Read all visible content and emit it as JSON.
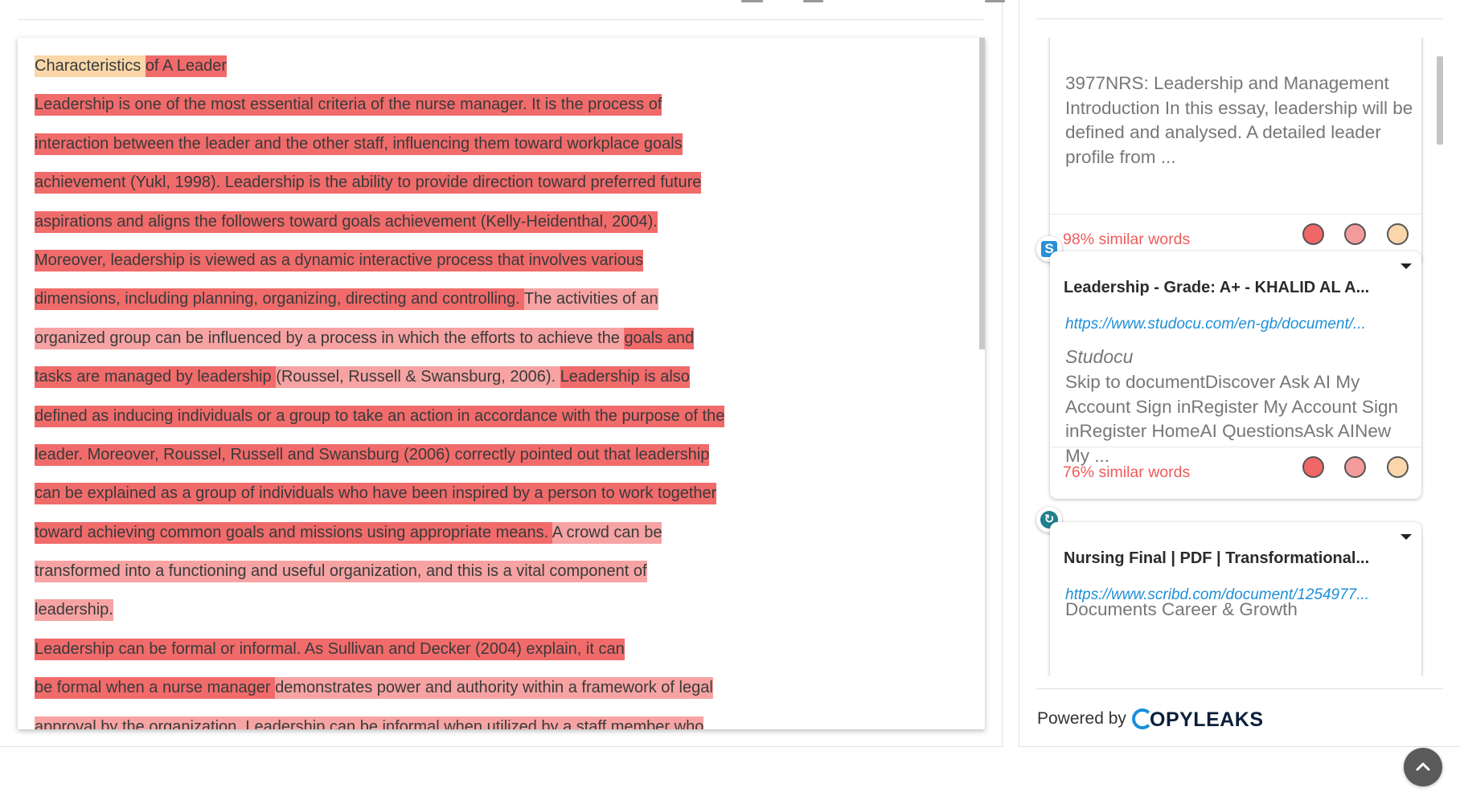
{
  "document": {
    "lines": [
      [
        [
          "peach",
          "Characteristics "
        ],
        [
          "strong",
          "of A Leader"
        ]
      ],
      [
        [
          "strong",
          "Leadership is one of the most essential criteria of the nurse manager. It is the process of"
        ]
      ],
      [
        [
          "strong",
          "interaction between the leader and the other staff, influencing them toward workplace goals"
        ]
      ],
      [
        [
          "strong",
          "achievement (Yukl, 1998). Leadership is the ability to provide direction toward preferred future"
        ]
      ],
      [
        [
          "strong",
          "aspirations and aligns the followers toward goals achievement (Kelly-Heidenthal, 2004)."
        ]
      ],
      [
        [
          "strong",
          "Moreover, leadership is viewed as a dynamic interactive process that involves various"
        ]
      ],
      [
        [
          "strong",
          "dimensions, including planning, organizing, directing and controlling. "
        ],
        [
          "light",
          "The activities of an"
        ]
      ],
      [
        [
          "light",
          "organized group can be influenced by a process in which the efforts to achieve the "
        ],
        [
          "strong",
          "goals and"
        ]
      ],
      [
        [
          "strong",
          "tasks are managed by leadership "
        ],
        [
          "light",
          "(Roussel, Russell & Swansburg, 2006). "
        ],
        [
          "strong",
          "Leadership is also"
        ]
      ],
      [
        [
          "strong",
          "defined as inducing individuals or a group to take an action in accordance with the purpose of the"
        ]
      ],
      [
        [
          "strong",
          "leader. Moreover, Roussel, Russell and Swansburg (2006) correctly pointed out that leadership"
        ]
      ],
      [
        [
          "strong",
          "can be explained as a group of individuals who have been inspired by a person to work together"
        ]
      ],
      [
        [
          "strong",
          "toward achieving common goals and missions using appropriate means. "
        ],
        [
          "light",
          "A crowd can be"
        ]
      ],
      [
        [
          "light",
          "transformed into a functioning and useful organization, and this is a vital component of"
        ]
      ],
      [
        [
          "light",
          "leadership."
        ]
      ],
      [
        [
          "strong",
          "Leadership can be formal or informal. As Sullivan and Decker (2004) explain, it can"
        ]
      ],
      [
        [
          "strong",
          "be formal when a nurse manager "
        ],
        [
          "light",
          "demonstrates power and authority within a framework of legal"
        ]
      ],
      [
        [
          "light",
          "approval by the organization. Leadership can be informal when utilized by a staff member who"
        ]
      ]
    ]
  },
  "sources": {
    "cards": [
      {
        "snippet": "3977NRS: Leadership and Management Introduction In this essay, leadership will be defined and analysed. A detailed leader profile from ...",
        "similarity": "98% similar words"
      },
      {
        "icon": "studocu-icon",
        "icon_letter": "S",
        "title": "Leadership - Grade: A+ - KHALID AL A...",
        "url": "https://www.studocu.com/en-gb/document/...",
        "site": "Studocu",
        "snippet": "Skip to documentDiscover Ask AI My Account Sign inRegister My Account Sign inRegister HomeAI QuestionsAsk AINew My ...",
        "similarity": "76% similar words"
      },
      {
        "icon": "scribd-icon",
        "title": "Nursing Final | PDF | Transformational...",
        "url": "https://www.scribd.com/document/1254977...",
        "snippet": "Documents Career & Growth"
      }
    ],
    "powered_by": "Powered by",
    "brand_name": "OPYLEAKS"
  },
  "colors": {
    "highlight_strong": "#f16b6b",
    "highlight_light": "#f7a3a3",
    "highlight_peach": "#f9d7a9",
    "url_blue": "#1e8fd8",
    "similar_red": "#ef5b5b"
  }
}
